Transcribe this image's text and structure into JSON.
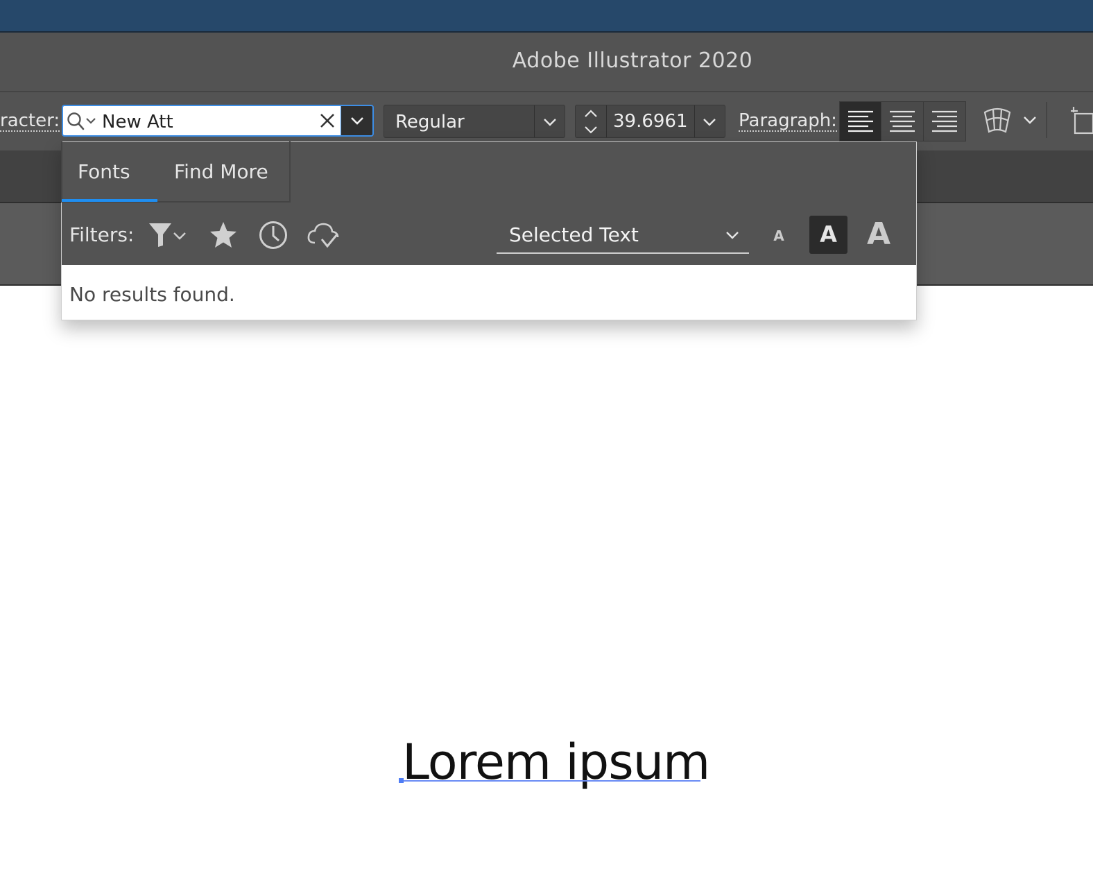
{
  "window": {
    "title": "Adobe Illustrator 2020"
  },
  "control_bar": {
    "character_label": "racter:",
    "font_search": {
      "value": "New Att"
    },
    "font_style": {
      "value": "Regular"
    },
    "font_size": {
      "value": "39.6961"
    },
    "paragraph_label": "Paragraph:",
    "paragraph_align": {
      "active": "left"
    }
  },
  "font_dropdown": {
    "tabs": [
      {
        "label": "Fonts",
        "active": true
      },
      {
        "label": "Find More",
        "active": false
      }
    ],
    "filters_label": "Filters:",
    "filter_icons": [
      "filter-icon",
      "star-icon",
      "clock-icon",
      "cloud-check-icon"
    ],
    "preview_text": {
      "value": "Selected Text"
    },
    "preview_sizes": [
      {
        "label": "A",
        "active": false
      },
      {
        "label": "A",
        "active": true
      },
      {
        "label": "A",
        "active": false
      }
    ],
    "results_message": "No results found."
  },
  "canvas": {
    "text": "Lorem ipsum"
  },
  "colors": {
    "accent": "#3d8ee6",
    "tab_underline": "#1f8ef1",
    "panel": "#535353",
    "desktop": "#26486a"
  }
}
